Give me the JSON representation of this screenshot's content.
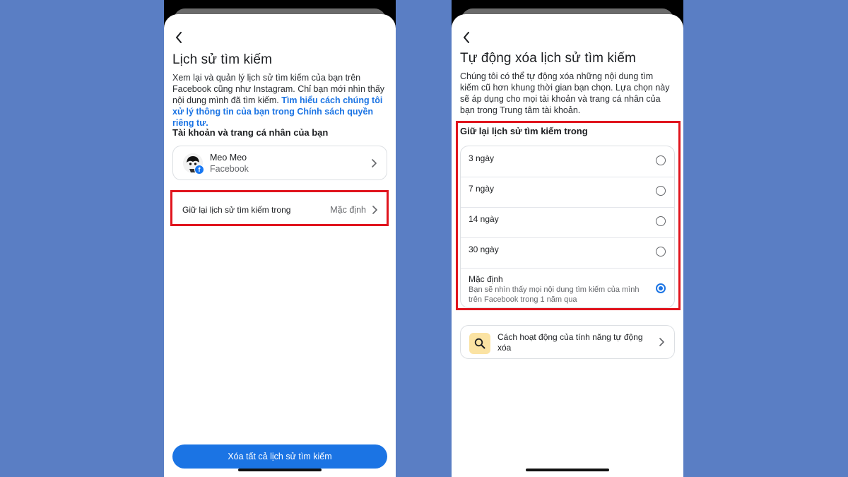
{
  "left": {
    "title": "Lịch sử tìm kiếm",
    "description": "Xem lại và quản lý lịch sử tìm kiếm của bạn trên Facebook cũng như Instagram. Chỉ bạn mới nhìn thấy nội dung mình đã tìm kiếm.",
    "link_text": "Tìm hiểu cách chúng tôi xử lý thông tin của bạn trong Chính sách quyền riêng tư.",
    "section_label": "Tài khoản và trang cá nhân của bạn",
    "account": {
      "name": "Meo Meo",
      "platform": "Facebook"
    },
    "retention_row": {
      "label": "Giữ lại lịch sử tìm kiếm trong",
      "value": "Mặc định"
    },
    "clear_button": "Xóa tất cả lịch sử tìm kiếm"
  },
  "right": {
    "title": "Tự động xóa lịch sử tìm kiếm",
    "description": "Chúng tôi có thể tự động xóa những nội dung tìm kiếm cũ hơn khung thời gian bạn chọn. Lựa chọn này sẽ áp dụng cho mọi tài khoản và trang cá nhân của bạn trong Trung tâm tài khoản.",
    "section_label": "Giữ lại lịch sử tìm kiếm trong",
    "options": [
      {
        "label": "3 ngày",
        "selected": false
      },
      {
        "label": "7 ngày",
        "selected": false
      },
      {
        "label": "14 ngày",
        "selected": false
      },
      {
        "label": "30 ngày",
        "selected": false
      },
      {
        "label": "Mặc định",
        "sub": "Bạn sẽ nhìn thấy mọi nội dung tìm kiếm của mình trên Facebook trong 1 năm qua",
        "selected": true
      }
    ],
    "info_card": "Cách hoạt động của tính năng tự động xóa"
  },
  "colors": {
    "background": "#5a7ec4",
    "accent": "#1b74e4",
    "highlight": "#e0141d"
  },
  "icons": {
    "back": "chevron-left-icon",
    "next": "chevron-right-icon",
    "search": "magnifier-icon",
    "facebook": "facebook-badge-icon"
  }
}
